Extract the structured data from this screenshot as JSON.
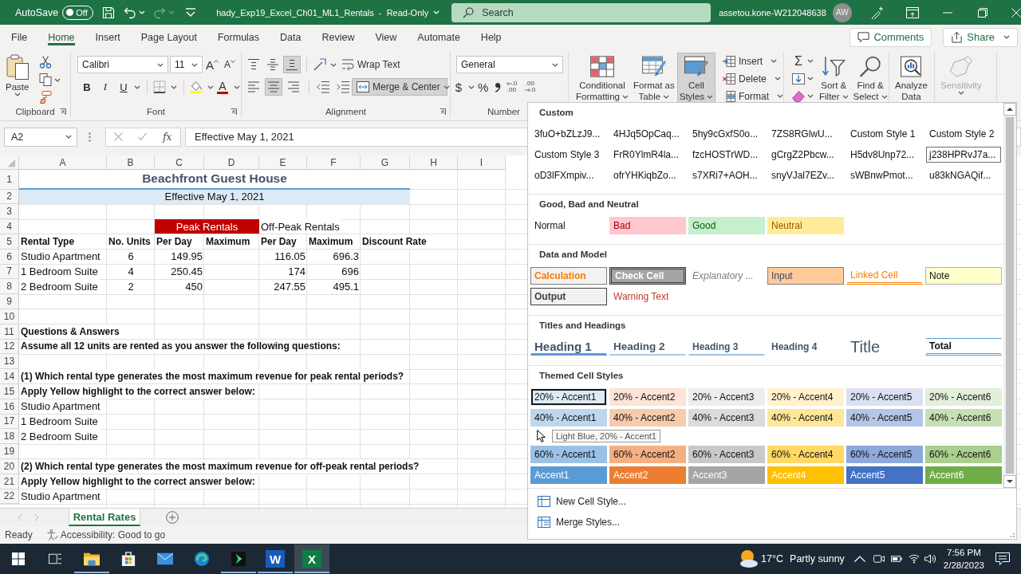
{
  "title_bar": {
    "autosave": {
      "label": "AutoSave",
      "state": "Off",
      "on": false
    },
    "redo_disabled": true,
    "document_title": "hady_Exp19_Excel_Ch01_ML1_Rentals  -  Read-Only",
    "search": {
      "placeholder": "Search"
    },
    "account": "assetou.kone-W212048638",
    "avatar": "AW"
  },
  "menu_tabs": [
    {
      "label": "File",
      "selected": false
    },
    {
      "label": "Home",
      "selected": true
    },
    {
      "label": "Insert",
      "selected": false
    },
    {
      "label": "Page Layout",
      "selected": false
    },
    {
      "label": "Formulas",
      "selected": false
    },
    {
      "label": "Data",
      "selected": false
    },
    {
      "label": "Review",
      "selected": false
    },
    {
      "label": "View",
      "selected": false
    },
    {
      "label": "Automate",
      "selected": false
    },
    {
      "label": "Help",
      "selected": false
    }
  ],
  "menu_actions": [
    {
      "label": "Comments",
      "kind": "comments"
    },
    {
      "label": "Share",
      "kind": "share"
    }
  ],
  "ribbon": {
    "clipboard": {
      "paste": "Paste",
      "group_label": "Clipboard"
    },
    "font": {
      "family": "Calibri",
      "size": "11",
      "grow": "A",
      "shrink": "A",
      "bold": "B",
      "italic": "I",
      "underline": "U",
      "color_letter": "A",
      "group_label": "Font"
    },
    "alignment": {
      "vertical": [
        {
          "kind": "top",
          "selected": false
        },
        {
          "kind": "middle",
          "selected": false
        },
        {
          "kind": "bottom",
          "selected": true
        }
      ],
      "horizontal": [
        {
          "kind": "left",
          "selected": false
        },
        {
          "kind": "center",
          "selected": true
        },
        {
          "kind": "right",
          "selected": false
        }
      ],
      "wrap_text": "Wrap Text",
      "merge": {
        "label": "Merge & Center",
        "selected": true
      },
      "group_label": "Alignment"
    },
    "number": {
      "format": "General",
      "currency": "$",
      "percent": "%",
      "decimals": [
        {
          "kind": "increase",
          "upper": ".0",
          "lower": ".00"
        },
        {
          "kind": "decrease",
          "upper": ".00",
          "lower": ".0"
        }
      ],
      "group_label": "Number"
    },
    "styles": [
      {
        "lines": [
          "Conditional",
          "Formatting"
        ],
        "kind": "conditional",
        "selected": false
      },
      {
        "lines": [
          "Format as",
          "Table"
        ],
        "kind": "table",
        "selected": false
      },
      {
        "lines": [
          "Cell",
          "Styles"
        ],
        "kind": "cellstyles",
        "selected": true
      }
    ],
    "cells": [
      {
        "label": "Insert",
        "kind": "insert"
      },
      {
        "label": "Delete",
        "kind": "delete"
      },
      {
        "label": "Format",
        "kind": "format"
      }
    ],
    "editing": {
      "autosum": "Σ",
      "tools": [
        {
          "lines": [
            "Sort &",
            "Filter"
          ],
          "kind": "sort"
        },
        {
          "lines": [
            "Find &",
            "Select"
          ],
          "kind": "find"
        }
      ]
    },
    "analyze": {
      "lines": [
        "Analyze",
        "Data"
      ]
    },
    "sensitivity": {
      "label": "Sensitivity",
      "disabled": true
    }
  },
  "formula_bar": {
    "name_box": "A2",
    "function_label": "fx",
    "formula": "Effective May 1, 2021"
  },
  "sheet": {
    "columns": [
      "A",
      "B",
      "C",
      "D",
      "E",
      "F",
      "G",
      "H",
      "I"
    ],
    "row_numbers": [
      "1",
      "2",
      "3",
      "4",
      "5",
      "6",
      "7",
      "8",
      "9",
      "10",
      "11",
      "12",
      "13",
      "14",
      "15",
      "16",
      "17",
      "18",
      "19",
      "20",
      "21",
      "22"
    ],
    "title": "Beachfront Guest House",
    "subtitle": "Effective May 1, 2021",
    "rental_groups": [
      {
        "label": "Peak Rentals",
        "highlighted": true
      },
      {
        "label": "Off-Peak Rentals",
        "highlighted": false
      }
    ],
    "table_headers": [
      "Rental Type",
      "No. Units",
      "Per Day",
      "Maximum",
      "Per Day",
      "Maximum",
      "Discount Rate"
    ],
    "table_rows": [
      {
        "rental_type": "Studio Apartment",
        "units": "6",
        "peak_per_day": "149.95",
        "off_peak_per_day": "116.05",
        "off_peak_maximum": "696.3"
      },
      {
        "rental_type": "1 Bedroom Suite",
        "units": "4",
        "peak_per_day": "250.45",
        "off_peak_per_day": "174",
        "off_peak_maximum": "696"
      },
      {
        "rental_type": "2 Bedroom Suite",
        "units": "2",
        "peak_per_day": "450",
        "off_peak_per_day": "247.55",
        "off_peak_maximum": "495.1"
      }
    ],
    "questions_heading": "Questions & Answers",
    "assumption": "Assume all 12 units are rented as you answer the following questions:",
    "questions": [
      {
        "question": "(1) Which rental type generates the most maximum revenue for peak rental periods?",
        "instruction": "Apply Yellow highlight to the correct answer below:",
        "options": [
          "Studio Apartment",
          "1 Bedroom Suite",
          "2 Bedroom Suite"
        ]
      },
      {
        "question": "(2) Which rental type generates the most maximum revenue for off-peak rental periods?",
        "instruction": "Apply Yellow highlight to the correct answer below:",
        "options": [
          "Studio Apartment"
        ]
      }
    ]
  },
  "sheet_tabs": [
    {
      "label": "Rental Rates",
      "selected": true
    }
  ],
  "status_bar": {
    "status": "Ready",
    "accessibility": "Accessibility: Good to go"
  },
  "cell_styles_menu": {
    "sections": [
      {
        "title": "Custom",
        "items": [
          {
            "label": "3fuO+bZLzJ9...",
            "kind": "plain",
            "selected": false,
            "hovered": false
          },
          {
            "label": "4HJq5OpCaq...",
            "kind": "plain",
            "selected": false,
            "hovered": false
          },
          {
            "label": "5hy9cGxfS0o...",
            "kind": "plain",
            "selected": false,
            "hovered": false
          },
          {
            "label": "7ZS8RGlwU...",
            "kind": "plain",
            "selected": false,
            "hovered": false
          },
          {
            "label": "Custom Style 1",
            "kind": "plain",
            "selected": false,
            "hovered": false
          },
          {
            "label": "Custom Style 2",
            "kind": "plain",
            "selected": false,
            "hovered": false
          },
          {
            "label": "Custom Style 3",
            "kind": "plain",
            "selected": false,
            "hovered": false
          },
          {
            "label": "FrR0YlmR4la...",
            "kind": "plain",
            "selected": false,
            "hovered": false
          },
          {
            "label": "fzcHOSTrWD...",
            "kind": "plain",
            "selected": false,
            "hovered": false
          },
          {
            "label": "gCrgZ2Pbcw...",
            "kind": "plain",
            "selected": false,
            "hovered": false
          },
          {
            "label": "H5dv8Unp72...",
            "kind": "plain",
            "selected": false,
            "hovered": false
          },
          {
            "label": "j238HPRvJ7a...",
            "kind": "plain",
            "selected": true,
            "hovered": false
          },
          {
            "label": "oD3lFXmpiv...",
            "kind": "plain",
            "selected": false,
            "hovered": false
          },
          {
            "label": "ofrYHKiqbZo...",
            "kind": "plain",
            "selected": false,
            "hovered": false
          },
          {
            "label": "s7XRi7+AOH...",
            "kind": "plain",
            "selected": false,
            "hovered": false
          },
          {
            "label": "snyVJal7EZv...",
            "kind": "plain",
            "selected": false,
            "hovered": false
          },
          {
            "label": "sWBnwPmot...",
            "kind": "plain",
            "selected": false,
            "hovered": false
          },
          {
            "label": "u83kNGAQif...",
            "kind": "plain",
            "selected": false,
            "hovered": false
          }
        ]
      },
      {
        "title": "Good, Bad and Neutral",
        "items": [
          {
            "label": "Normal",
            "kind": "normal",
            "selected": false,
            "hovered": false
          },
          {
            "label": "Bad",
            "kind": "bad",
            "selected": false,
            "hovered": false
          },
          {
            "label": "Good",
            "kind": "good",
            "selected": false,
            "hovered": false
          },
          {
            "label": "Neutral",
            "kind": "neutral",
            "selected": false,
            "hovered": false
          }
        ]
      },
      {
        "title": "Data and Model",
        "items": [
          {
            "label": "Calculation",
            "kind": "calculation",
            "selected": false,
            "hovered": false
          },
          {
            "label": "Check Cell",
            "kind": "check",
            "selected": false,
            "hovered": false
          },
          {
            "label": "Explanatory ...",
            "kind": "explanatory",
            "selected": false,
            "hovered": false
          },
          {
            "label": "Input",
            "kind": "input",
            "selected": false,
            "hovered": false
          },
          {
            "label": "Linked Cell",
            "kind": "linked",
            "selected": false,
            "hovered": false
          },
          {
            "label": "Note",
            "kind": "note",
            "selected": false,
            "hovered": false
          },
          {
            "label": "Output",
            "kind": "output",
            "selected": false,
            "hovered": false
          },
          {
            "label": "Warning Text",
            "kind": "warning",
            "selected": false,
            "hovered": false
          }
        ]
      },
      {
        "title": "Titles and Headings",
        "items": [
          {
            "label": "Heading 1",
            "kind": "heading1",
            "selected": false,
            "hovered": false
          },
          {
            "label": "Heading 2",
            "kind": "heading2",
            "selected": false,
            "hovered": false
          },
          {
            "label": "Heading 3",
            "kind": "heading3",
            "selected": false,
            "hovered": false
          },
          {
            "label": "Heading 4",
            "kind": "heading4",
            "selected": false,
            "hovered": false
          },
          {
            "label": "Title",
            "kind": "title",
            "selected": false,
            "hovered": false
          },
          {
            "label": "Total",
            "kind": "total",
            "selected": false,
            "hovered": false
          }
        ]
      },
      {
        "title": "Themed Cell Styles",
        "tooltip": "Light Blue, 20% - Accent1",
        "items": [
          {
            "label": "20% - Accent1",
            "kind": "tint",
            "color": "#ddebf7",
            "selected": false,
            "hovered": true
          },
          {
            "label": "20% - Accent2",
            "kind": "tint",
            "color": "#fce4d6",
            "selected": false,
            "hovered": false
          },
          {
            "label": "20% - Accent3",
            "kind": "tint",
            "color": "#ededed",
            "selected": false,
            "hovered": false
          },
          {
            "label": "20% - Accent4",
            "kind": "tint",
            "color": "#fff2cc",
            "selected": false,
            "hovered": false
          },
          {
            "label": "20% - Accent5",
            "kind": "tint",
            "color": "#d9e1f2",
            "selected": false,
            "hovered": false
          },
          {
            "label": "20% - Accent6",
            "kind": "tint",
            "color": "#e2efda",
            "selected": false,
            "hovered": false
          },
          {
            "label": "40% - Accent1",
            "kind": "tint",
            "color": "#bdd7ee",
            "selected": false,
            "hovered": false
          },
          {
            "label": "40% - Accent2",
            "kind": "tint",
            "color": "#f8cbad",
            "selected": false,
            "hovered": false
          },
          {
            "label": "40% - Accent3",
            "kind": "tint",
            "color": "#dbdbdb",
            "selected": false,
            "hovered": false
          },
          {
            "label": "40% - Accent4",
            "kind": "tint",
            "color": "#ffe699",
            "selected": false,
            "hovered": false
          },
          {
            "label": "40% - Accent5",
            "kind": "tint",
            "color": "#b4c6e7",
            "selected": false,
            "hovered": false
          },
          {
            "label": "40% - Accent6",
            "kind": "tint",
            "color": "#c6e0b4",
            "selected": false,
            "hovered": false
          },
          {
            "label": "60% - Accent1",
            "kind": "tint",
            "color": "#9bc2e6",
            "selected": false,
            "hovered": false
          },
          {
            "label": "60% - Accent2",
            "kind": "tint",
            "color": "#f4b084",
            "selected": false,
            "hovered": false
          },
          {
            "label": "60% - Accent3",
            "kind": "tint",
            "color": "#c9c9c9",
            "selected": false,
            "hovered": false
          },
          {
            "label": "60% - Accent4",
            "kind": "tint",
            "color": "#ffd966",
            "selected": false,
            "hovered": false
          },
          {
            "label": "60% - Accent5",
            "kind": "tint",
            "color": "#8ea9db",
            "selected": false,
            "hovered": false
          },
          {
            "label": "60% - Accent6",
            "kind": "tint",
            "color": "#a9d08e",
            "selected": false,
            "hovered": false
          },
          {
            "label": "Accent1",
            "kind": "accent",
            "color": "#5b9bd5",
            "selected": false,
            "hovered": false
          },
          {
            "label": "Accent2",
            "kind": "accent",
            "color": "#ed7d31",
            "selected": false,
            "hovered": false
          },
          {
            "label": "Accent3",
            "kind": "accent",
            "color": "#a5a5a5",
            "selected": false,
            "hovered": false
          },
          {
            "label": "Accent4",
            "kind": "accent",
            "color": "#ffc000",
            "selected": false,
            "hovered": false
          },
          {
            "label": "Accent5",
            "kind": "accent",
            "color": "#4472c4",
            "selected": false,
            "hovered": false
          },
          {
            "label": "Accent6",
            "kind": "accent",
            "color": "#70ad47",
            "selected": false,
            "hovered": false
          }
        ]
      }
    ],
    "actions": [
      {
        "label": "New Cell Style...",
        "kind": "new"
      },
      {
        "label": "Merge Styles...",
        "kind": "merge"
      }
    ]
  },
  "taskbar": {
    "apps": [
      {
        "kind": "start",
        "running": false,
        "active": false
      },
      {
        "kind": "taskview",
        "running": false,
        "active": false
      },
      {
        "kind": "explorer",
        "running": true,
        "active": false
      },
      {
        "kind": "store",
        "running": false,
        "active": false
      },
      {
        "kind": "mail",
        "running": false,
        "active": false
      },
      {
        "kind": "edge",
        "running": false,
        "active": false
      },
      {
        "kind": "arrowapp",
        "running": true,
        "active": false
      },
      {
        "kind": "word",
        "glyph": "W",
        "running": true,
        "active": false
      },
      {
        "kind": "excel",
        "glyph": "X",
        "running": true,
        "active": true
      }
    ],
    "weather": {
      "temperature": "17°C",
      "condition": "Partly sunny"
    },
    "time": "7:56 PM",
    "date": "2/28/2023"
  }
}
